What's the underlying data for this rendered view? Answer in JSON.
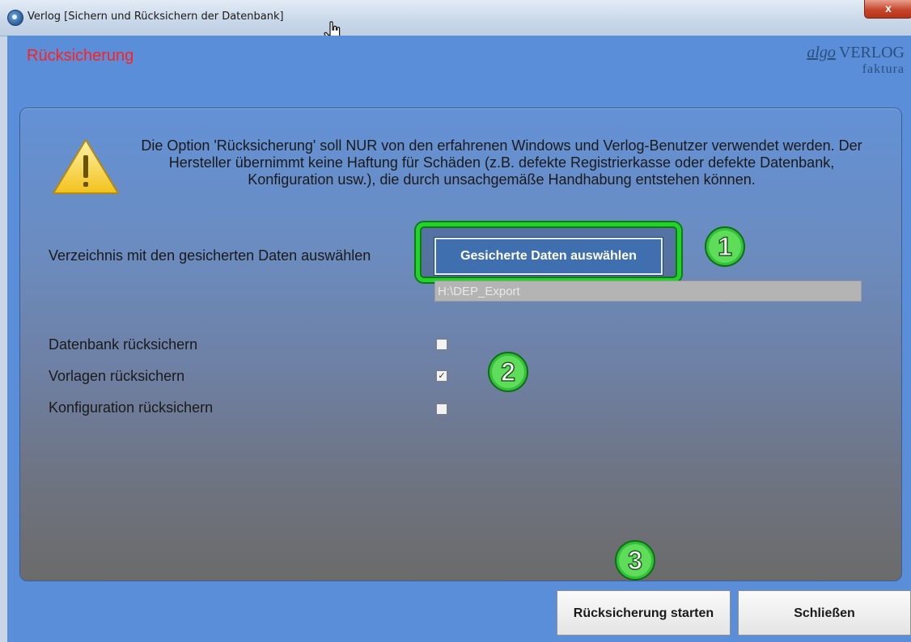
{
  "window": {
    "title": "Verlog [Sichern und Rücksichern der Datenbank]",
    "close_label": "x"
  },
  "header": {
    "title": "Rücksicherung",
    "logo_algo": "algo",
    "logo_verlog": "VERLOG",
    "logo_faktura": "faktura"
  },
  "warning": {
    "icon": "warning-triangle-icon",
    "text": "Die Option 'Rücksicherung' soll NUR von den erfahrenen Windows und Verlog-Benutzer verwendet werden. Der Hersteller übernimmt keine Haftung für Schäden (z.B. defekte Registrierkasse oder defekte Datenbank, Konfiguration usw.), die durch unsachgemäße Handhabung entstehen können."
  },
  "directory": {
    "label": "Verzeichnis mit den gesicherten Daten auswählen",
    "button_label": "Gesicherte Daten auswählen",
    "path_value": "H:\\DEP_Export"
  },
  "options": [
    {
      "label": "Datenbank rücksichern",
      "checked": false
    },
    {
      "label": "Vorlagen rücksichern",
      "checked": true
    },
    {
      "label": "Konfiguration rücksichern",
      "checked": false
    }
  ],
  "annotations": [
    "1",
    "2",
    "3"
  ],
  "footer": {
    "start_label": "Rücksicherung starten",
    "close_label": "Schließen"
  },
  "colors": {
    "heading": "#ff2020",
    "client_bg": "#5b8ed9",
    "highlight": "#22d32a",
    "primary_button": "#3f6fae"
  }
}
